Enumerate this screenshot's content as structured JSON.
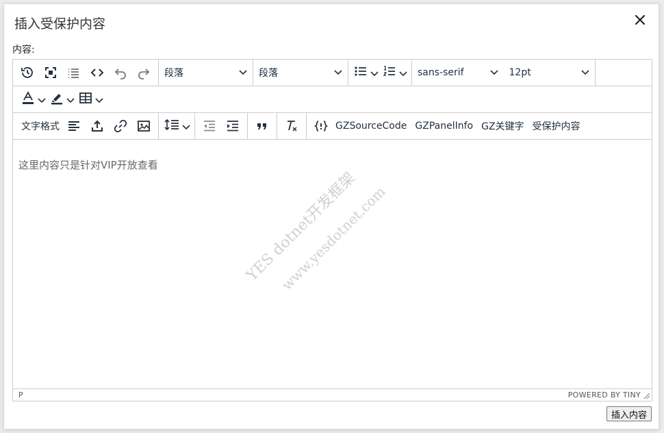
{
  "dialog": {
    "title": "插入受保护内容",
    "content_label": "内容:",
    "insert_button": "插入内容"
  },
  "toolbar": {
    "row1": {
      "icons": [
        "history-icon",
        "fullscreen-icon",
        "list-lines-icon",
        "code-icon",
        "undo-icon",
        "redo-icon"
      ],
      "block_format_1": "段落",
      "block_format_2": "段落",
      "font_family": "sans-serif",
      "font_size": "12pt"
    },
    "row3": {
      "text_format_label": "文字格式",
      "custom_buttons": [
        "GZSourceCode",
        "GZPanelInfo",
        "GZ关键字",
        "受保护内容"
      ]
    }
  },
  "editor": {
    "content": "这里内容只是针对VIP开放查看",
    "watermark_line1": "YES dotnet开发框架",
    "watermark_line2": "www.yesdotnet.com"
  },
  "statusbar": {
    "path": "P",
    "brand": "POWERED BY TINY"
  },
  "colors": {
    "border": "#cccccc",
    "text": "#222f3e",
    "background": "#ffffff"
  }
}
